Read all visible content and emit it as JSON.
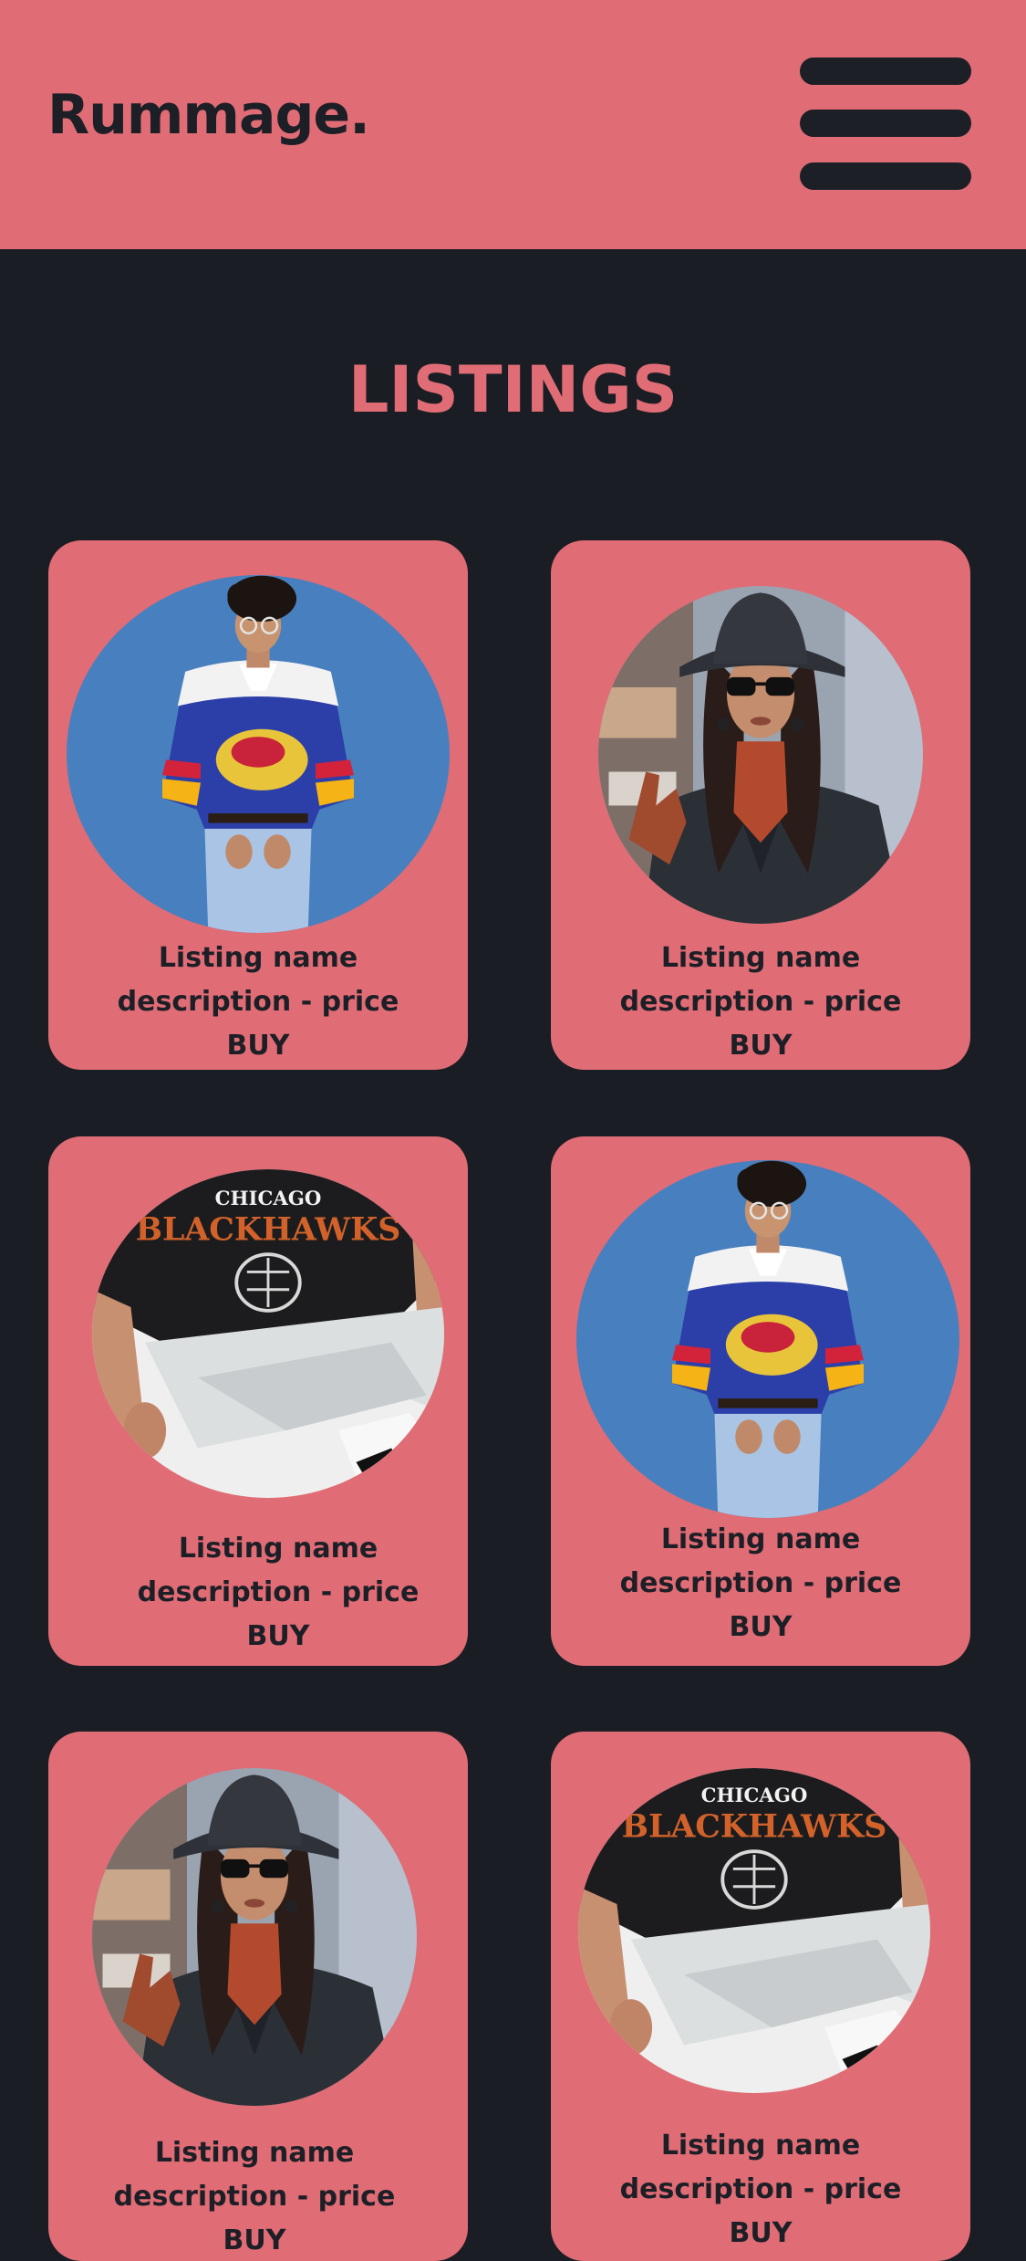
{
  "header": {
    "logo": "Rummage.",
    "menu_icon": "hamburger-menu-icon"
  },
  "page": {
    "title": "LISTINGS"
  },
  "colors": {
    "accent": "#e06c75",
    "background": "#1a1d24",
    "text_dark": "#1d1f27"
  },
  "listings": [
    {
      "name": "Listing name",
      "desc": "description - price",
      "buy": "BUY",
      "image": "man-blue-hockey-jersey-photo"
    },
    {
      "name": "Listing name",
      "desc": "description - price",
      "buy": "BUY",
      "image": "woman-black-hat-coat-photo"
    },
    {
      "name": "Listing name",
      "desc": "description - price",
      "buy": "BUY",
      "image": "man-blackhawks-tshirt-photo"
    },
    {
      "name": "Listing name",
      "desc": "description - price",
      "buy": "BUY",
      "image": "man-blue-hockey-jersey-photo"
    },
    {
      "name": "Listing name",
      "desc": "description - price",
      "buy": "BUY",
      "image": "woman-black-hat-coat-photo"
    },
    {
      "name": "Listing name",
      "desc": "description - price",
      "buy": "BUY",
      "image": "man-blackhawks-tshirt-photo"
    }
  ]
}
